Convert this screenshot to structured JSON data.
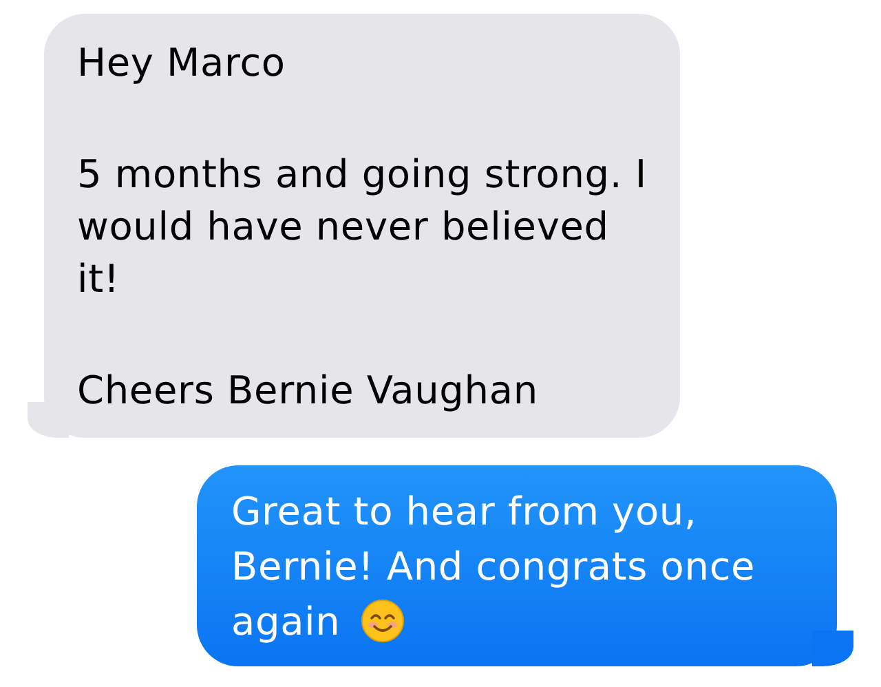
{
  "messages": [
    {
      "kind": "received",
      "paragraphs": [
        "Hey Marco",
        "5 months and going strong. I would have never believed it!",
        "Cheers Bernie Vaughan"
      ]
    },
    {
      "kind": "sent",
      "paragraphs": [
        "Great to hear from you, Bernie! And congrats once again"
      ],
      "emoji": true
    }
  ]
}
